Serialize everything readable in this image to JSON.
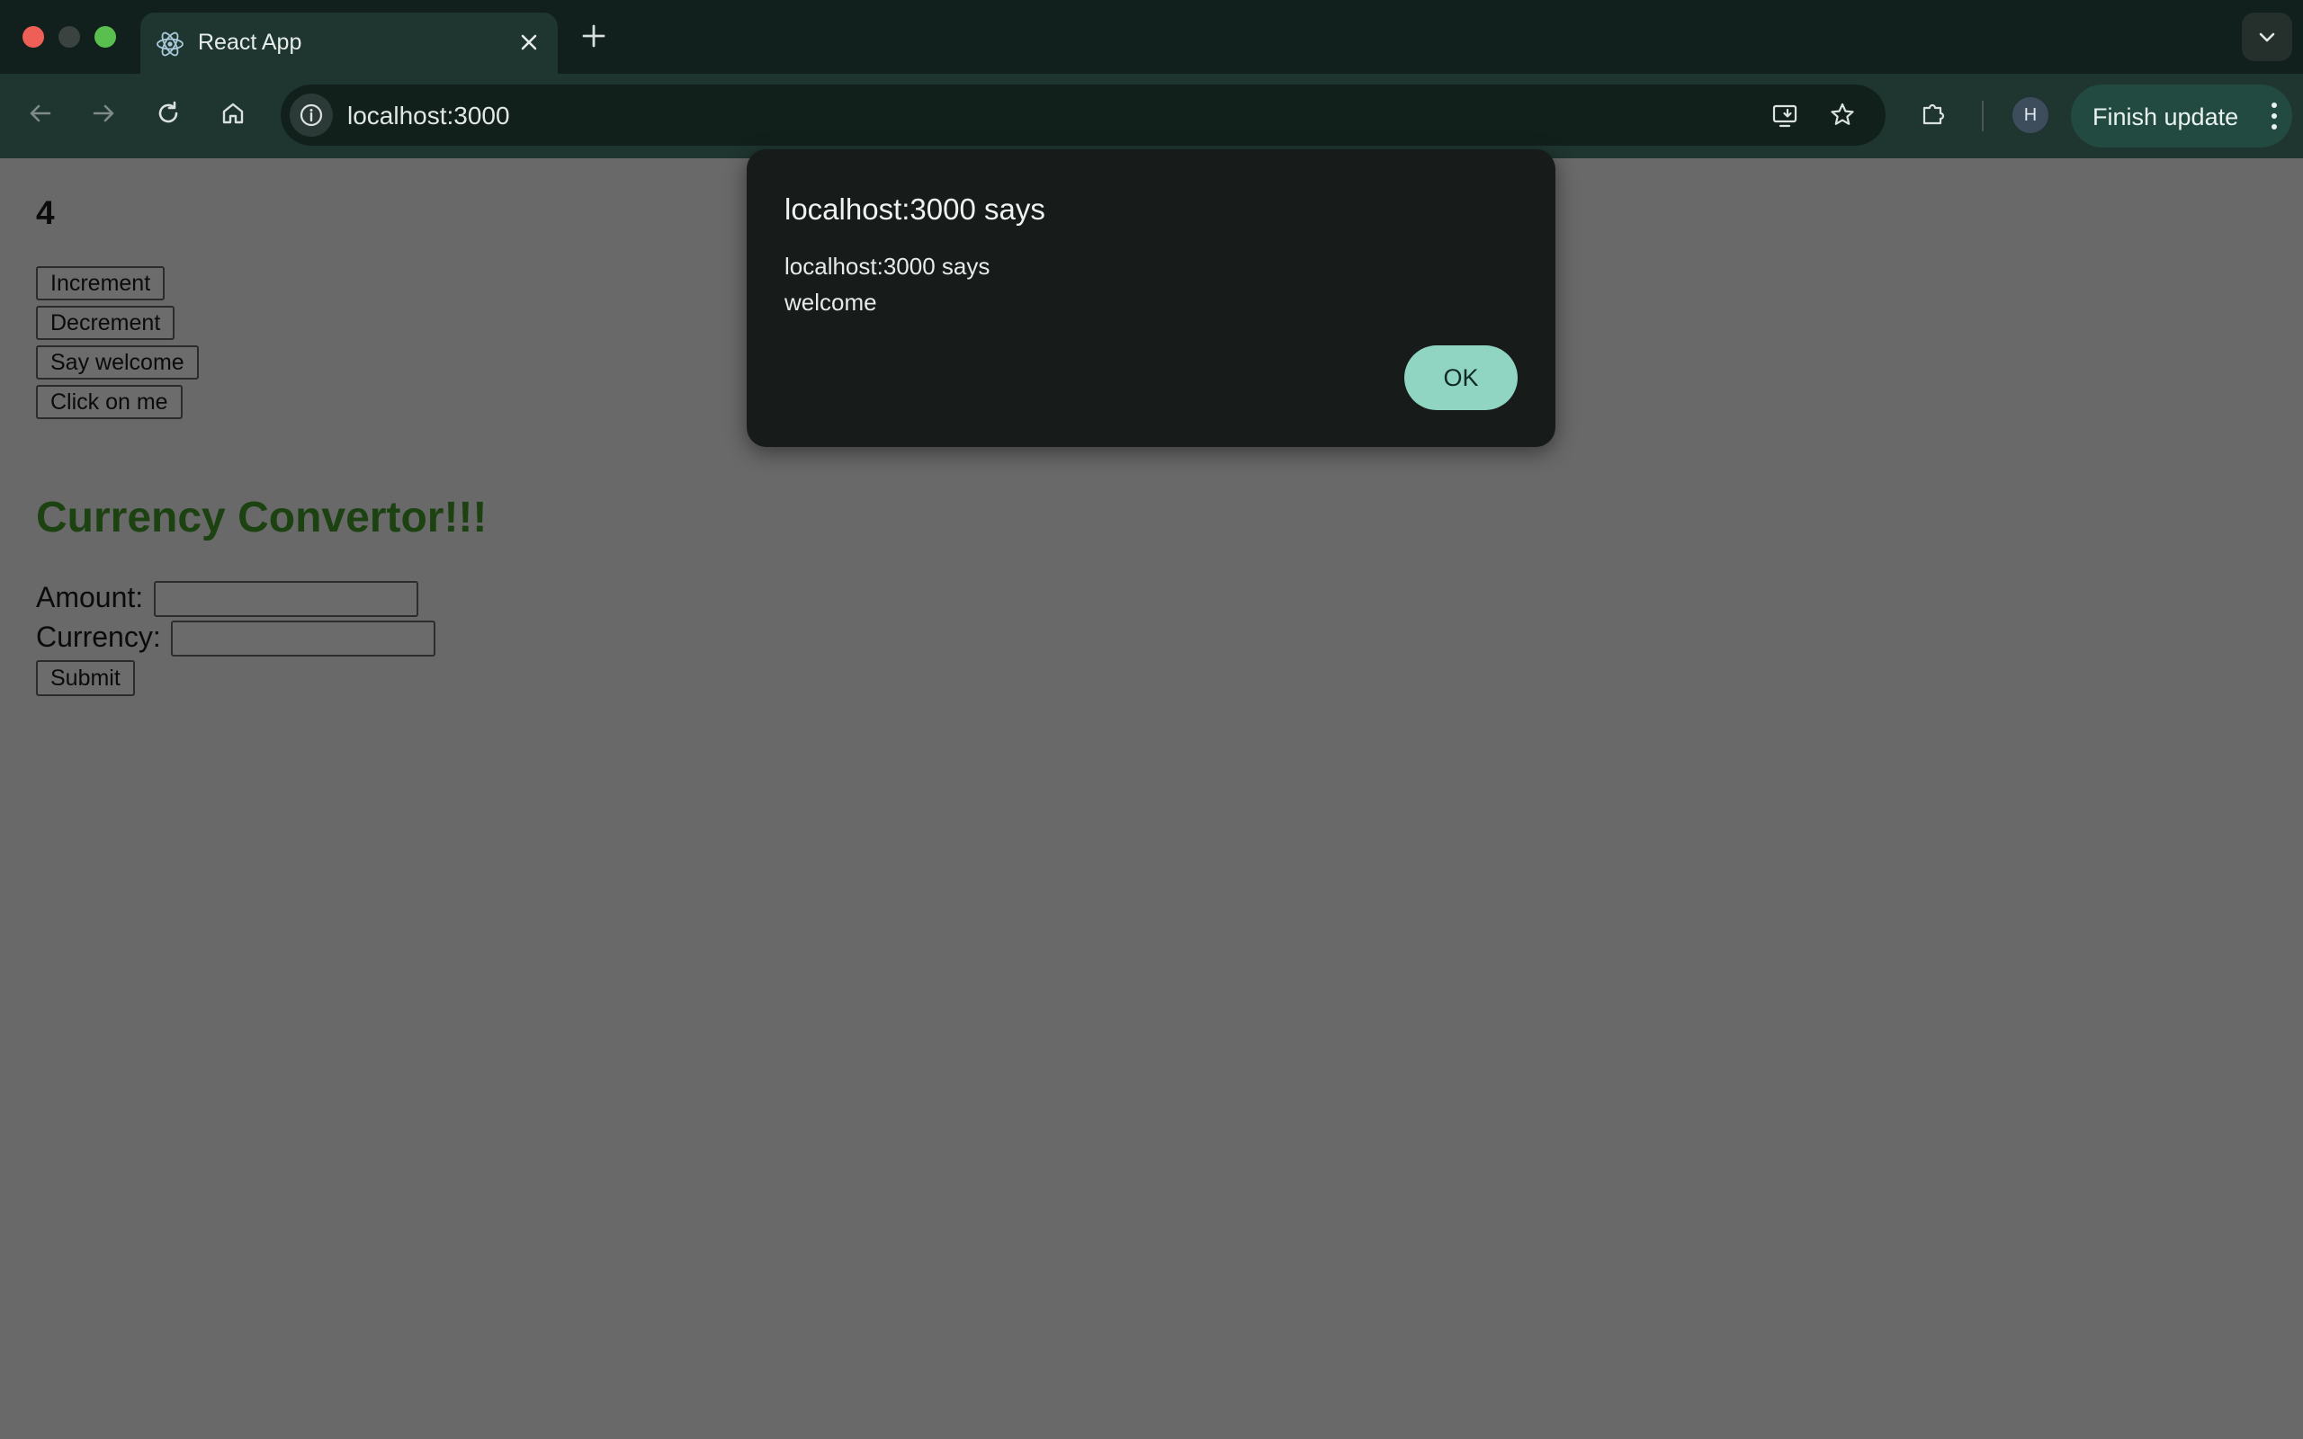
{
  "browser": {
    "tab": {
      "title": "React App",
      "favicon": "react-icon"
    },
    "address": "localhost:3000",
    "profile_initial": "H",
    "update_button": "Finish update"
  },
  "page": {
    "counter": "4",
    "buttons": [
      "Increment",
      "Decrement",
      "Say welcome",
      "Click on me"
    ],
    "heading": "Currency Convertor!!!",
    "heading_color": "#1d4212",
    "form": {
      "amount_label": "Amount:",
      "amount_value": "",
      "currency_label": "Currency:",
      "currency_value": "",
      "submit_label": "Submit"
    }
  },
  "dialog": {
    "title": "localhost:3000 says",
    "message_line1": "localhost:3000 says",
    "message_line2": "welcome",
    "ok_label": "OK",
    "ok_color": "#8fd5c1"
  }
}
